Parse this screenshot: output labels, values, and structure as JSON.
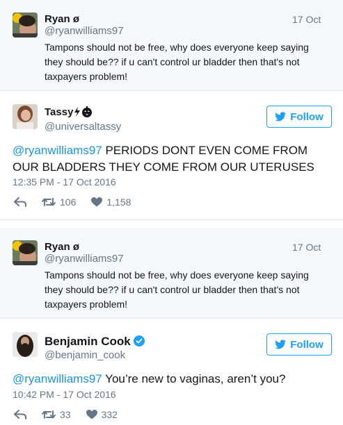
{
  "quote1": {
    "name": "Ryan ø",
    "handle": "@ryanwilliams97",
    "date": "17 Oct",
    "text": "Tampons should not be free, why does everyone keep saying they should be?? if u can't control ur bladder then that's not taxpayers problem!"
  },
  "reply1": {
    "name": "Tassy",
    "handle": "@universaltassy",
    "follow_label": "Follow",
    "mention": "@ryanwilliams97",
    "text": " PERIODS DONT EVEN COME FROM OUR BLADDERS THEY COME FROM OUR UTERUSES",
    "timestamp": "12:35 PM - 17 Oct 2016",
    "retweets": "106",
    "likes": "1,158"
  },
  "quote2": {
    "name": "Ryan ø",
    "handle": "@ryanwilliams97",
    "date": "17 Oct",
    "text": "Tampons should not be free, why does everyone keep saying they should be?? if u can't control ur bladder then that's not taxpayers problem!"
  },
  "reply2": {
    "name": "Benjamin Cook",
    "handle": "@benjamin_cook",
    "follow_label": "Follow",
    "mention": "@ryanwilliams97",
    "text": " You’re new to vaginas, aren’t you?",
    "timestamp": "10:42 PM - 17 Oct 2016",
    "retweets": "33",
    "likes": "332"
  },
  "colors": {
    "twitter_blue": "#1da1f2",
    "mention_blue": "#1b95e0",
    "quote_bg": "#f5f8fa",
    "muted": "#657786"
  }
}
